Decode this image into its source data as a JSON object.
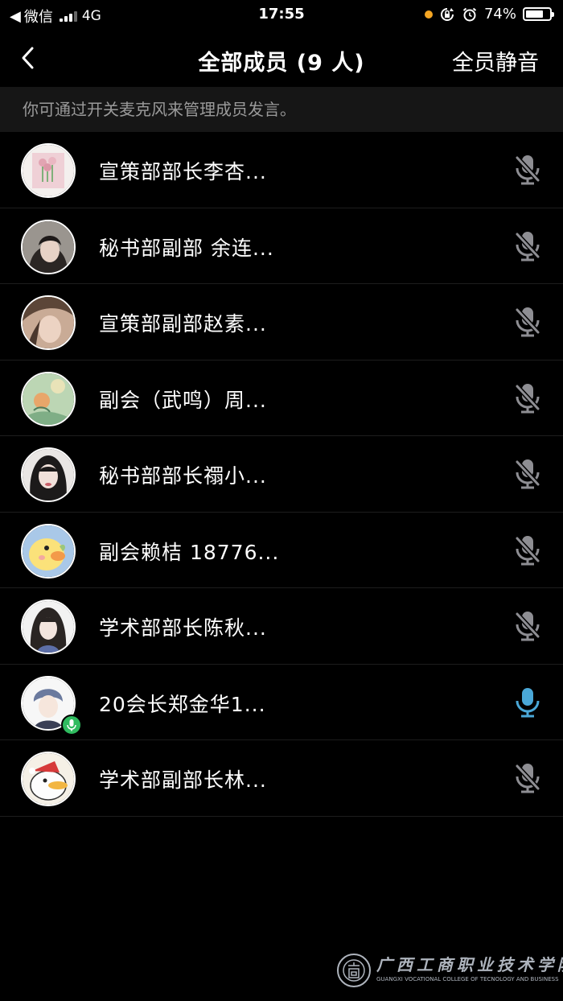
{
  "status_bar": {
    "back_app": "◀",
    "carrier": "微信",
    "network": "4G",
    "time": "17:55",
    "battery_percent": "74%",
    "battery_level": 0.74,
    "colors": {
      "orange_dot": "#f5a623"
    }
  },
  "nav": {
    "back_icon": "chevron-left-icon",
    "title": "全部成员 (9 人)",
    "mute_all_label": "全员静音"
  },
  "hint": "你可通过开关麦克风来管理成员发言。",
  "members": [
    {
      "name": "宣策部部长李杏...",
      "mic": "muted",
      "speaking": false
    },
    {
      "name": "秘书部副部 余连...",
      "mic": "muted",
      "speaking": false
    },
    {
      "name": "宣策部副部赵素...",
      "mic": "muted",
      "speaking": false
    },
    {
      "name": "副会（武鸣）周...",
      "mic": "muted",
      "speaking": false
    },
    {
      "name": "秘书部部长禤小...",
      "mic": "muted",
      "speaking": false
    },
    {
      "name": "副会赖桔 18776...",
      "mic": "muted",
      "speaking": false
    },
    {
      "name": "学术部部长陈秋...",
      "mic": "muted",
      "speaking": false
    },
    {
      "name": "20会长郑金华1...",
      "mic": "on",
      "speaking": true
    },
    {
      "name": "学术部副部长林...",
      "mic": "muted",
      "speaking": false
    }
  ],
  "colors": {
    "mic_muted": "#8e8e93",
    "mic_on": "#4aa8d8",
    "speaking_badge": "#2fbb5f"
  },
  "watermark": {
    "name_cn": "广西工商职业技术学院",
    "name_en": "GUANGXI VOCATIONAL COLLEGE OF TECNOLOGY AND BUSINESS"
  }
}
